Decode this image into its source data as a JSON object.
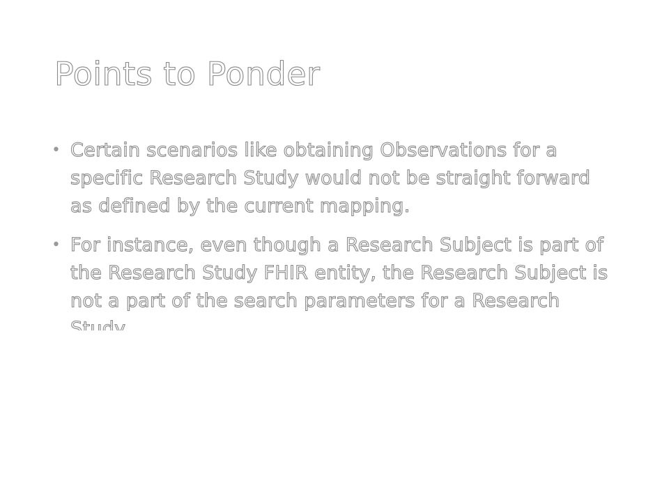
{
  "slide": {
    "title": "Points to Ponder",
    "bullets": [
      {
        "marker": "•",
        "text": "Certain scenarios like obtaining Observations for a specific Research Study would not be straight forward as defined by the current mapping."
      },
      {
        "marker": "•",
        "text": "For instance, even though a Research Subject is part of the Research Study FHIR entity, the Research Subject is not a part of the search parameters for a Research Study."
      }
    ]
  },
  "colors": {
    "background": "#ffffff",
    "text_outline": "#8a8a8a",
    "text_fill": "#ffffff"
  }
}
